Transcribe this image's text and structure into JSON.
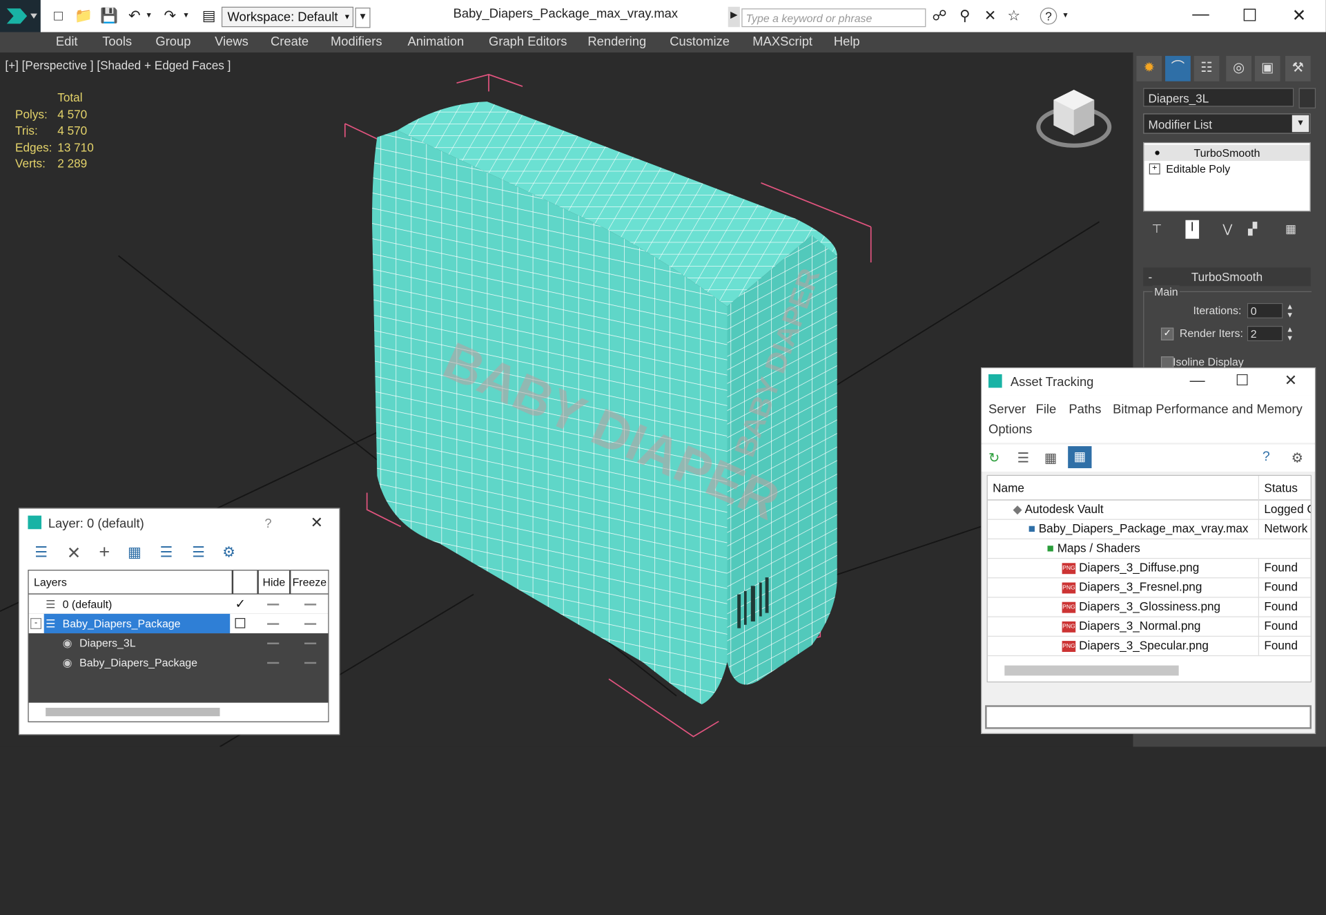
{
  "window": {
    "title": "Baby_Diapers_Package_max_vray.max",
    "workspace_label": "Workspace: Default",
    "search_placeholder": "Type a keyword or phrase"
  },
  "menu": [
    "Edit",
    "Tools",
    "Group",
    "Views",
    "Create",
    "Modifiers",
    "Animation",
    "Graph Editors",
    "Rendering",
    "Customize",
    "MAXScript",
    "Help"
  ],
  "viewport": {
    "label": "[+] [Perspective ] [Shaded + Edged Faces ]",
    "stats": {
      "header": "Total",
      "rows": [
        {
          "key": "Polys:",
          "value": "4 570"
        },
        {
          "key": "Tris:",
          "value": "4 570"
        },
        {
          "key": "Edges:",
          "value": "13 710"
        },
        {
          "key": "Verts:",
          "value": "2 289"
        }
      ]
    },
    "package_text": "BABY DIAPER"
  },
  "command_panel": {
    "object_name": "Diapers_3L",
    "modifier_list": "Modifier List",
    "stack": [
      "TurboSmooth",
      "Editable Poly"
    ],
    "turbosmooth": {
      "title": "TurboSmooth",
      "group": "Main",
      "iterations_label": "Iterations:",
      "iterations_value": "0",
      "render_iters_label": "Render Iters:",
      "render_iters_value": "2",
      "isoline_label": "Isoline Display"
    }
  },
  "asset_tracking": {
    "title": "Asset Tracking",
    "menu": [
      "Server",
      "File",
      "Paths",
      "Bitmap Performance and Memory",
      "Options"
    ],
    "columns": {
      "name": "Name",
      "status": "Status"
    },
    "rows": [
      {
        "name": "Autodesk Vault",
        "status": "Logged C",
        "icon": "vault-icon",
        "indent": 0
      },
      {
        "name": "Baby_Diapers_Package_max_vray.max",
        "status": "Network I",
        "icon": "max-file-icon",
        "indent": 1
      },
      {
        "name": "Maps / Shaders",
        "status": "",
        "icon": "maps-icon",
        "indent": 2
      },
      {
        "name": "Diapers_3_Diffuse.png",
        "status": "Found",
        "icon": "png-icon",
        "indent": 3
      },
      {
        "name": "Diapers_3_Fresnel.png",
        "status": "Found",
        "icon": "png-icon",
        "indent": 3
      },
      {
        "name": "Diapers_3_Glossiness.png",
        "status": "Found",
        "icon": "png-icon",
        "indent": 3
      },
      {
        "name": "Diapers_3_Normal.png",
        "status": "Found",
        "icon": "png-icon",
        "indent": 3
      },
      {
        "name": "Diapers_3_Specular.png",
        "status": "Found",
        "icon": "png-icon",
        "indent": 3
      }
    ],
    "png_badge": "PNG"
  },
  "layer_panel": {
    "title": "Layer: 0 (default)",
    "help": "?",
    "columns": {
      "layers": "Layers",
      "hide": "Hide",
      "freeze": "Freeze"
    },
    "rows": [
      {
        "name": "0 (default)",
        "indent": 0,
        "selected": false,
        "checked": true
      },
      {
        "name": "Baby_Diapers_Package",
        "indent": 0,
        "selected": true,
        "checked": false
      },
      {
        "name": "Diapers_3L",
        "indent": 1,
        "selected": false,
        "checked": false
      },
      {
        "name": "Baby_Diapers_Package",
        "indent": 1,
        "selected": false,
        "checked": false
      }
    ]
  },
  "colors": {
    "mesh": "#5fd6c8",
    "wire": "#ffffff",
    "bbox": "#e2547f",
    "stats": "#e4d36a",
    "selection": "#2f7fd6"
  }
}
